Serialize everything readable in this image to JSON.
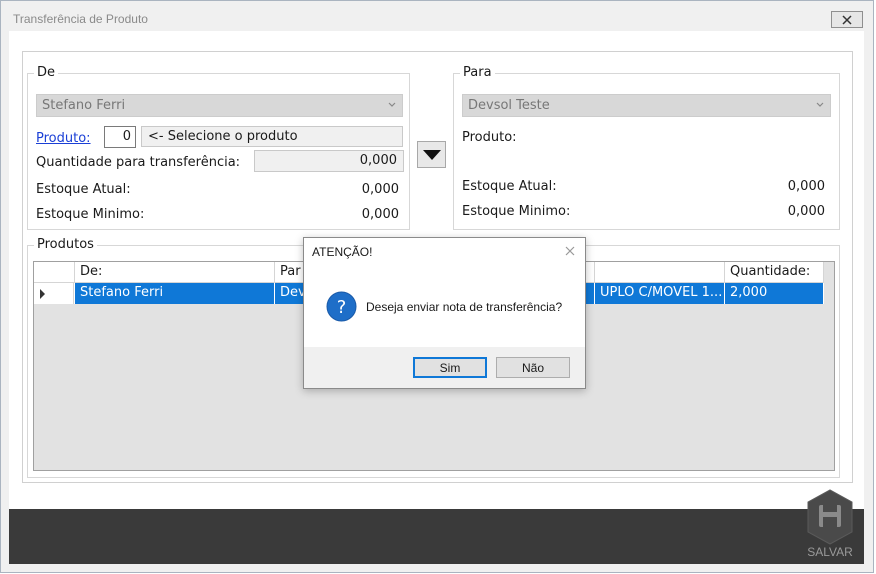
{
  "window": {
    "title": "Transferência de Produto"
  },
  "de": {
    "group_title": "De",
    "combo_value": "Stefano Ferri",
    "produto_link": "Produto:",
    "produto_code": "0",
    "produto_select": "<- Selecione o produto",
    "quantidade_label": "Quantidade para transferência:",
    "quantidade_value": "0,000",
    "estoque_atual_label": "Estoque Atual:",
    "estoque_atual_value": "0,000",
    "estoque_minimo_label": "Estoque Minimo:",
    "estoque_minimo_value": "0,000"
  },
  "para": {
    "group_title": "Para",
    "combo_value": "Devsol Teste",
    "produto_label": "Produto:",
    "estoque_atual_label": "Estoque Atual:",
    "estoque_atual_value": "0,000",
    "estoque_minimo_label": "Estoque Minimo:",
    "estoque_minimo_value": "0,000"
  },
  "produtos": {
    "group_title": "Produtos",
    "columns": [
      "De:",
      "Par",
      "Quantidade:"
    ],
    "rows": [
      {
        "de": "Stefano Ferri",
        "para": "Dev",
        "produto": "UPLO C/MOVEL 1...",
        "quantidade": "2,000"
      }
    ]
  },
  "footer": {
    "save_label": "SALVAR"
  },
  "dialog": {
    "title": "ATENÇÃO!",
    "message": "Deseja enviar nota de transferência?",
    "yes_label": "Sim",
    "no_label": "Não"
  },
  "colors": {
    "selection": "#0f78d7",
    "footer": "#3a3a3a",
    "link": "#1a3fd6"
  }
}
